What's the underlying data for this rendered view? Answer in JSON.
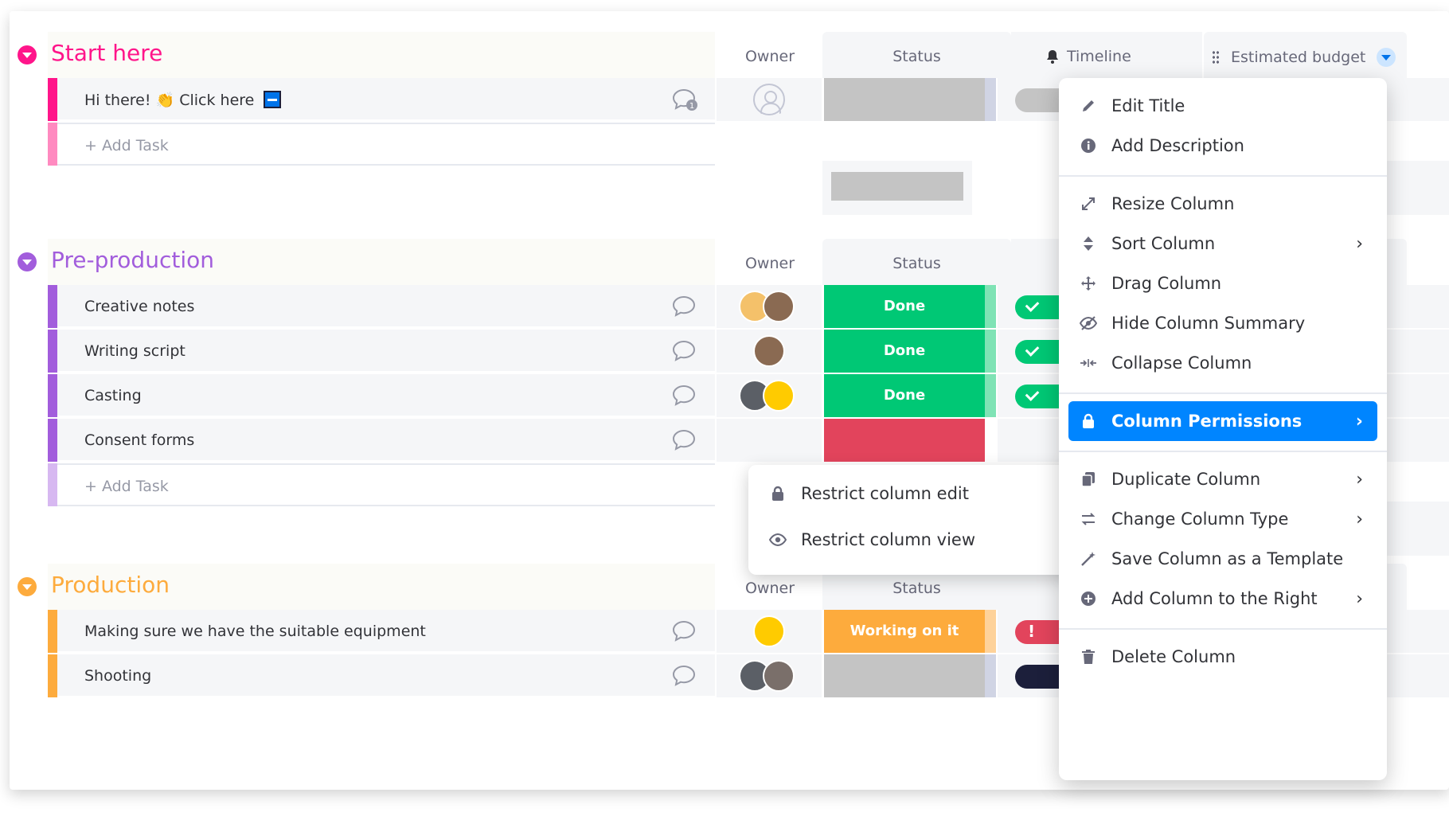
{
  "colors": {
    "start_here": "#ff158a",
    "pre_production": "#a25ddc",
    "production": "#fdab3d",
    "done": "#00c875",
    "working": "#fdab3d",
    "stuck": "#e2445c",
    "accent": "#0085ff"
  },
  "groups": [
    {
      "title": "Start here",
      "owner_label": "Owner",
      "status_label": "Status",
      "timeline_label": "Timeline",
      "budget_label": "Estimated budget",
      "rows": [
        {
          "name": "Hi there! 👏 Click here",
          "status": ""
        }
      ],
      "add_task": "+ Add Task"
    },
    {
      "title": "Pre-production",
      "owner_label": "Owner",
      "status_label": "Status",
      "rows": [
        {
          "name": "Creative notes",
          "status": "Done"
        },
        {
          "name": "Writing script",
          "status": "Done"
        },
        {
          "name": "Casting",
          "status": "Done"
        },
        {
          "name": "Consent forms",
          "status": ""
        }
      ],
      "add_task": "+ Add Task"
    },
    {
      "title": "Production",
      "owner_label": "Owner",
      "status_label": "Status",
      "rows": [
        {
          "name": "Making sure we have the suitable equipment",
          "status": "Working on it"
        },
        {
          "name": "Shooting",
          "status": ""
        }
      ]
    }
  ],
  "menu": {
    "items": [
      {
        "label": "Edit Title",
        "icon": "pencil-icon"
      },
      {
        "label": "Add Description",
        "icon": "info-icon"
      },
      {
        "label": "Resize Column",
        "icon": "resize-icon"
      },
      {
        "label": "Sort Column",
        "icon": "sort-icon"
      },
      {
        "label": "Drag Column",
        "icon": "drag-icon"
      },
      {
        "label": "Hide Column Summary",
        "icon": "eye-off-icon"
      },
      {
        "label": "Collapse Column",
        "icon": "collapse-icon"
      },
      {
        "label": "Column Permissions",
        "icon": "lock-icon"
      },
      {
        "label": "Duplicate Column",
        "icon": "duplicate-icon"
      },
      {
        "label": "Change Column Type",
        "icon": "swap-icon"
      },
      {
        "label": "Save Column as a Template",
        "icon": "wand-icon"
      },
      {
        "label": "Add Column to the Right",
        "icon": "plus-circle-icon"
      },
      {
        "label": "Delete Column",
        "icon": "trash-icon"
      }
    ]
  },
  "submenu": {
    "items": [
      {
        "label": "Restrict column edit",
        "icon": "lock-icon"
      },
      {
        "label": "Restrict column view",
        "icon": "eye-icon"
      }
    ]
  }
}
